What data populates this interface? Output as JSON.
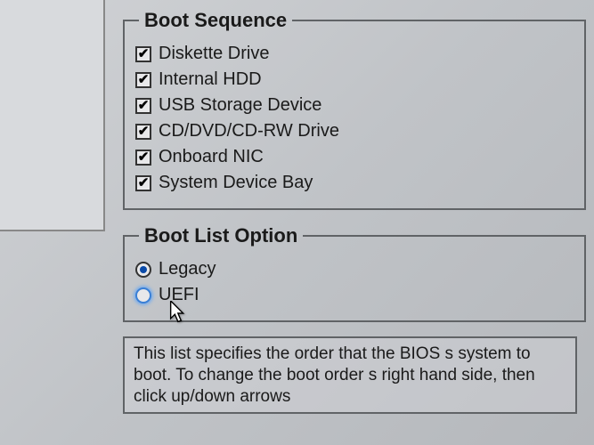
{
  "bootSequence": {
    "title": "Boot Sequence",
    "items": [
      {
        "label": "Diskette Drive"
      },
      {
        "label": "Internal HDD"
      },
      {
        "label": "USB Storage Device"
      },
      {
        "label": "CD/DVD/CD-RW Drive"
      },
      {
        "label": "Onboard NIC"
      },
      {
        "label": "System Device Bay"
      }
    ]
  },
  "bootListOption": {
    "title": "Boot List Option",
    "options": [
      {
        "label": "Legacy"
      },
      {
        "label": "UEFI"
      }
    ]
  },
  "helpText": "This list specifies the order that the BIOS s\nsystem to boot. To change the boot order s\nright hand side, then click up/down arrows"
}
